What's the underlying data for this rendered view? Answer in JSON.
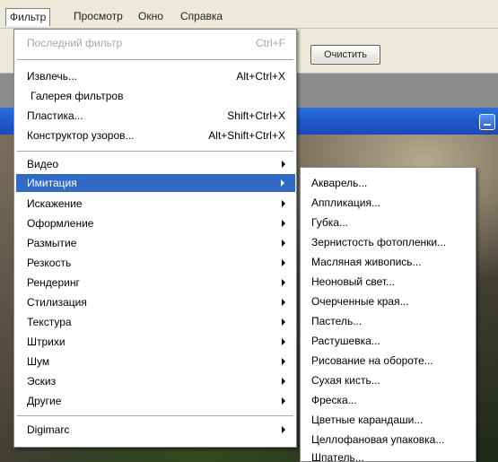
{
  "menubar": {
    "items": [
      "Фильтр",
      "Просмотр",
      "Окно",
      "Справка"
    ]
  },
  "toolbar": {
    "clear_label": "Очистить"
  },
  "filter_menu": {
    "last_filter": {
      "label": "Последний фильтр",
      "shortcut": "Ctrl+F",
      "disabled": true
    },
    "group_tools": [
      {
        "label": "Извлечь...",
        "shortcut": "Alt+Ctrl+X"
      },
      {
        "label": "Галерея фильтров",
        "shortcut": ""
      },
      {
        "label": "Пластика...",
        "shortcut": "Shift+Ctrl+X"
      },
      {
        "label": "Конструктор узоров...",
        "shortcut": "Alt+Shift+Ctrl+X"
      }
    ],
    "group_filters": [
      {
        "label": "Видео"
      },
      {
        "label": "Имитация",
        "selected": true
      },
      {
        "label": "Искажение"
      },
      {
        "label": "Оформление"
      },
      {
        "label": "Размытие"
      },
      {
        "label": "Резкость"
      },
      {
        "label": "Рендеринг"
      },
      {
        "label": "Стилизация"
      },
      {
        "label": "Текстура"
      },
      {
        "label": "Штрихи"
      },
      {
        "label": "Шум"
      },
      {
        "label": "Эскиз"
      },
      {
        "label": "Другие"
      }
    ],
    "plugins": [
      {
        "label": "Digimarc"
      }
    ]
  },
  "imitation_submenu": {
    "items": [
      "Акварель...",
      "Аппликация...",
      "Губка...",
      "Зернистость фотопленки...",
      "Масляная живопись...",
      "Неоновый свет...",
      "Очерченные края...",
      "Пастель...",
      "Растушевка...",
      "Рисование на обороте...",
      "Сухая кисть...",
      "Фреска...",
      "Цветные карандаши...",
      "Целлофановая упаковка...",
      "Шпатель..."
    ]
  },
  "colors": {
    "selection": "#316ac5",
    "menu_bg": "#ffffff",
    "disabled_text": "#a6a6a6",
    "titlebar": "#1e55c9"
  }
}
